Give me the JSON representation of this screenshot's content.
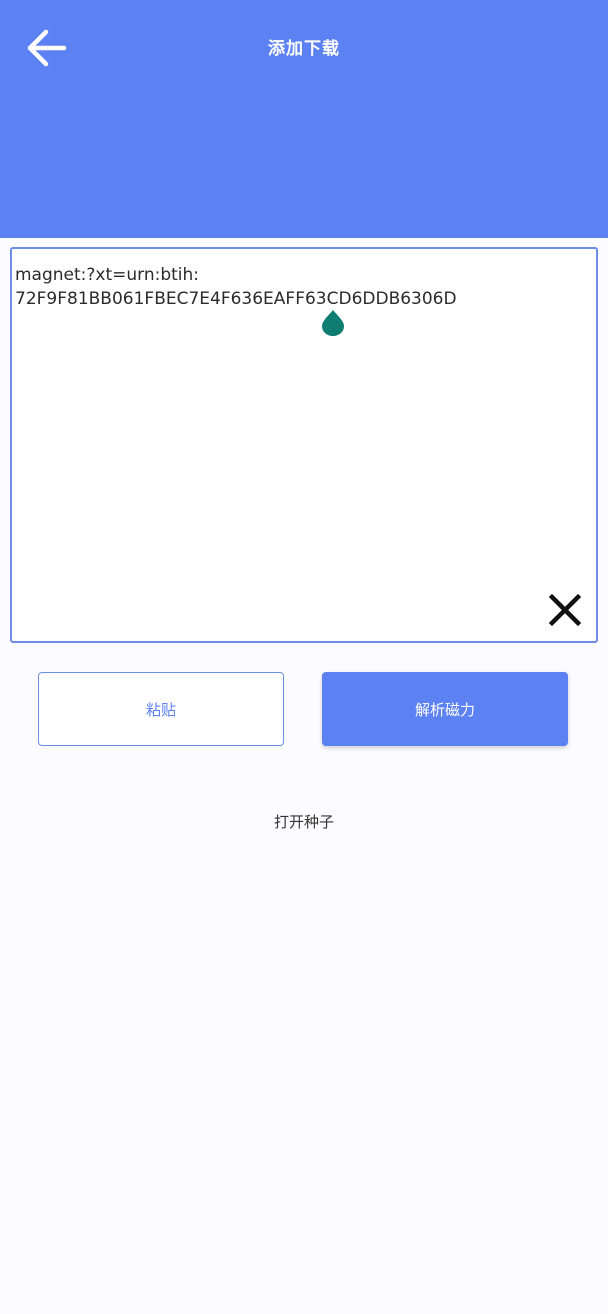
{
  "header": {
    "title": "添加下载",
    "back_icon": "arrow-left-icon",
    "background_color": "#5b81f2"
  },
  "input": {
    "value": "magnet:?xt=urn:btih:\n72F9F81BB061FBEC7E4F636EAFF63CD6DDB6306D",
    "clear_icon": "close-icon",
    "cursor_handle_color": "#0f7d72"
  },
  "actions": {
    "paste_label": "粘贴",
    "parse_label": "解析磁力",
    "open_torrent_label": "打开种子"
  }
}
